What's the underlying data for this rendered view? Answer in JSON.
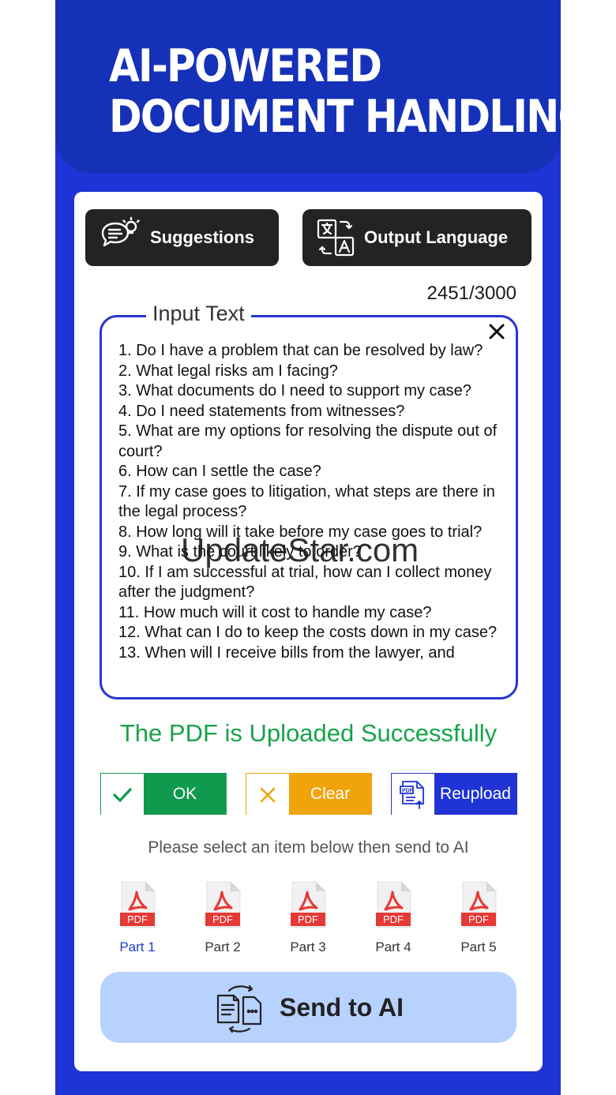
{
  "header": {
    "line1": "AI-POWERED",
    "line2": "DOCUMENT HANDLING"
  },
  "toolbar": {
    "suggestions_label": "Suggestions",
    "output_language_label": "Output Language"
  },
  "counter": "2451/3000",
  "input": {
    "legend": "Input Text",
    "text": "1. Do I have a problem that can be resolved by law?\n2. What legal risks am I facing?\n3. What documents do I need to support my case?\n4. Do I need statements from witnesses?\n5. What are my options for resolving the dispute out of court?\n6. How can I settle the case?\n7. If my case goes to litigation, what steps are there in the legal process?\n8. How long will it take before my case goes to trial?\n9. What is the court likely to order?\n10. If I am successful at trial, how can I collect money after the judgment?\n11. How much will it cost to handle my case?\n12. What can I do to keep the costs down in my case?\n13. When will I receive bills from the lawyer, and"
  },
  "watermark": "UpdateStar.com",
  "status": {
    "message": "The PDF is Uploaded Successfully",
    "color": "#17a34a"
  },
  "actions": {
    "ok_label": "OK",
    "clear_label": "Clear",
    "reupload_label": "Reupload"
  },
  "hint": "Please select an item below then send to AI",
  "parts": [
    {
      "label": "Part 1",
      "badge": "PDF",
      "selected": true
    },
    {
      "label": "Part 2",
      "badge": "PDF",
      "selected": false
    },
    {
      "label": "Part 3",
      "badge": "PDF",
      "selected": false
    },
    {
      "label": "Part 4",
      "badge": "PDF",
      "selected": false
    },
    {
      "label": "Part 5",
      "badge": "PDF",
      "selected": false
    }
  ],
  "send": {
    "label": "Send to AI"
  },
  "colors": {
    "brand_blue": "#1f33d6",
    "header_blue": "#1531b8",
    "ok_green": "#0f9a4e",
    "clear_orange": "#f0a30a",
    "send_bg": "#b8d2ff",
    "pdf_red": "#e53935"
  }
}
